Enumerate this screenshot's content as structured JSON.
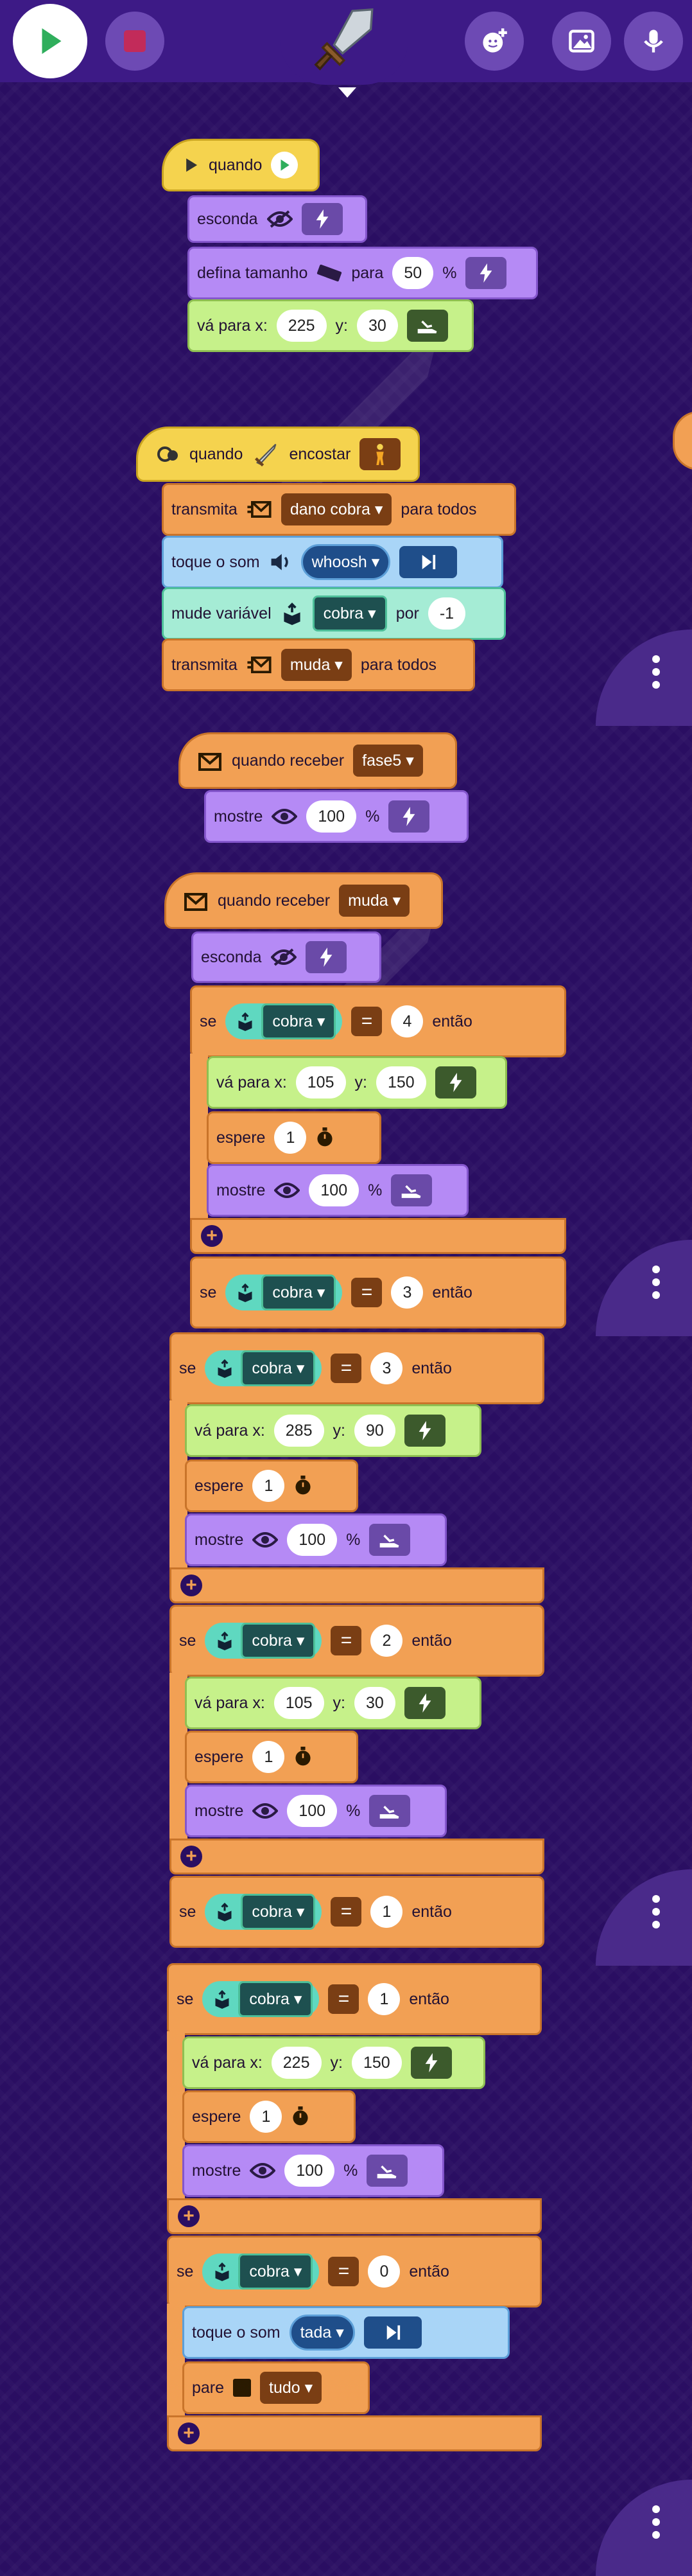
{
  "top": {
    "play_icon": "play-icon",
    "stop_icon": "stop-icon",
    "sprite_icon": "sword-sprite-icon",
    "add_sprite_icon": "add-sprite-icon",
    "image_icon": "image-icon",
    "mic_icon": "microphone-icon"
  },
  "colors": {
    "bg": "#2a0e62",
    "orange": "#f2a054",
    "purple": "#b58af5",
    "green": "#c6f18a",
    "yellow": "#f5d34e",
    "blue": "#a9d5f7",
    "teal": "#a5ecd5"
  },
  "s1": {
    "when": "quando",
    "hide": "esconda",
    "set_size": "defina tamanho",
    "for": "para",
    "size": "50",
    "pct": "%",
    "goto": "vá para x:",
    "x": "225",
    "y_lbl": "y:",
    "y": "30"
  },
  "s2": {
    "when": "quando",
    "touch": "encostar",
    "broadcast": "transmita",
    "msg1": "dano cobra",
    "to_all": "para todos",
    "play_sound": "toque o som",
    "sound": "whoosh",
    "change_var": "mude variável",
    "var": "cobra",
    "by": "por",
    "by_val": "-1",
    "broadcast2": "transmita",
    "msg2": "muda",
    "to_all2": "para todos"
  },
  "s3": {
    "when_receive": "quando receber",
    "msg": "fase5",
    "show": "mostre",
    "val": "100",
    "pct": "%"
  },
  "s4": {
    "when_receive": "quando receber",
    "msg": "muda",
    "hide": "esconda",
    "if": "se",
    "then": "então",
    "var": "cobra",
    "eq": "=",
    "goto": "vá para x:",
    "y_lbl": "y:",
    "wait": "espere",
    "show": "mostre",
    "pct": "%",
    "c1": {
      "val": "4",
      "x": "105",
      "y": "150",
      "wait": "1",
      "show": "100"
    },
    "c1b": {
      "val": "3"
    },
    "c2": {
      "val": "3",
      "x": "285",
      "y": "90",
      "wait": "1",
      "show": "100"
    },
    "c3": {
      "val": "2",
      "x": "105",
      "y": "30",
      "wait": "1",
      "show": "100"
    },
    "c4a": {
      "val": "1"
    },
    "c4": {
      "val": "1",
      "x": "225",
      "y": "150",
      "wait": "1",
      "show": "100"
    },
    "c5": {
      "val": "0",
      "play_sound": "toque o som",
      "sound": "tada",
      "stop": "pare",
      "stop_opt": "tudo"
    }
  }
}
